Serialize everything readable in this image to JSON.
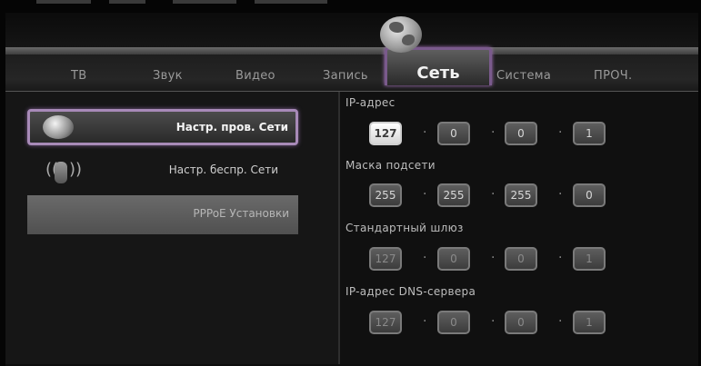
{
  "tabs": [
    {
      "label": "ТВ",
      "active": false
    },
    {
      "label": "Звук",
      "active": false
    },
    {
      "label": "Видео",
      "active": false
    },
    {
      "label": "Запись",
      "active": false
    },
    {
      "label": "Сеть",
      "active": true
    },
    {
      "label": "Система",
      "active": false
    },
    {
      "label": "ПРОЧ.",
      "active": false
    }
  ],
  "active_tab_icon": "globe-icon",
  "sidebar": {
    "items": [
      {
        "label": "Настр. пров. Сети",
        "icon": "wired-network-globe-icon",
        "selected": true
      },
      {
        "label": "Настр. беспр. Сети",
        "icon": "wireless-antenna-icon",
        "selected": false
      },
      {
        "label": "PPPoE Установки",
        "icon": "",
        "selected": false,
        "disabled": true
      }
    ]
  },
  "network": {
    "ip_label": "IP-адрес",
    "ip": [
      "127",
      "0",
      "0",
      "1"
    ],
    "mask_label": "Маска подсети",
    "mask": [
      "255",
      "255",
      "255",
      "0"
    ],
    "gateway_label": "Стандартный шлюз",
    "gateway": [
      "127",
      "0",
      "0",
      "1"
    ],
    "dns_label": "IP-адрес DNS-сервера",
    "dns": [
      "127",
      "0",
      "0",
      "1"
    ]
  },
  "colors": {
    "focus_border": "#a88ab8",
    "background": "#0e0e0e"
  }
}
